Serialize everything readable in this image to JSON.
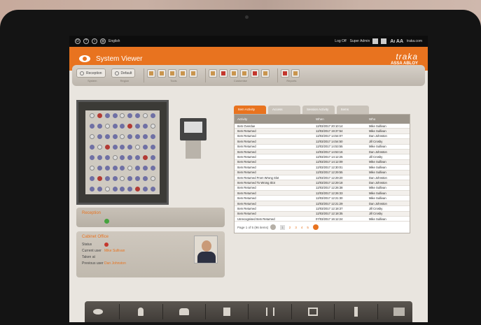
{
  "topbar": {
    "language": "English",
    "log_off": "Log Off",
    "user": "Super Admin",
    "text_size": "Aı AA",
    "site": "traka.com"
  },
  "header": {
    "title": "System Viewer",
    "brand": "traka",
    "brand_sub": "ASSA ABLOY"
  },
  "toolbar": {
    "system_value": "Reception",
    "system_caption": "System",
    "region_value": "Default",
    "region_caption": "Region",
    "tools_caption": "Tools",
    "customise_caption": "Customise",
    "reports_caption": "Reports"
  },
  "reception": {
    "title": "Reception"
  },
  "cabinet_panel": {
    "title": "Cabinet Office",
    "status_label": "Status",
    "current_user_label": "Current user",
    "current_user": "Mike Sullivan",
    "taken_at_label": "Taken at",
    "previous_user_label": "Previous user",
    "previous_user": "Dan Johnston"
  },
  "activity": {
    "tabs": [
      "Item Activity",
      "Access",
      "Session Activity",
      "Items"
    ],
    "columns": [
      "Activity",
      "When",
      "Who"
    ],
    "rows": [
      [
        "Item Overdue",
        "12/03/2017 20:10:14",
        "Mike Sullivan"
      ],
      [
        "Item Returned",
        "12/03/2017 19:37:54",
        "Mike Sullivan"
      ],
      [
        "Item Returned",
        "12/03/2017 14:54:07",
        "Dan Johnston"
      ],
      [
        "Item Returned",
        "12/03/2017 14:54:50",
        "Jill Crosby"
      ],
      [
        "Item Returned",
        "12/03/2017 14:53:55",
        "Mike Sullivan"
      ],
      [
        "Item Returned",
        "12/03/2017 14:53:16",
        "Dan Johnston"
      ],
      [
        "Item Returned",
        "12/03/2017 14:12:25",
        "Jill Crosby"
      ],
      [
        "Item Returned",
        "12/03/2017 14:12:09",
        "Mike Sullivan"
      ],
      [
        "Item Returned",
        "12/03/2017 12:30:01",
        "Mike Sullivan"
      ],
      [
        "Item Returned",
        "12/03/2017 12:29:55",
        "Mike Sullivan"
      ],
      [
        "Item Returned From Wrong Slot",
        "12/03/2017 12:29:20",
        "Dan Johnston"
      ],
      [
        "Item Returned To Wrong Slot",
        "12/03/2017 12:29:18",
        "Dan Johnston"
      ],
      [
        "Item Returned",
        "12/03/2017 12:26:38",
        "Mike Sullivan"
      ],
      [
        "Item Returned",
        "12/03/2017 12:26:33",
        "Mike Sullivan"
      ],
      [
        "Item Returned",
        "12/03/2017 12:21:30",
        "Mike Sullivan"
      ],
      [
        "Item Returned",
        "12/03/2017 12:21:29",
        "Dan Johnston"
      ],
      [
        "Item Returned",
        "12/03/2017 12:18:37",
        "Jill Crosby"
      ],
      [
        "Item Returned",
        "12/03/2017 12:18:35",
        "Jill Crosby"
      ],
      [
        "Unrecognised Item Returned",
        "07/03/2017 16:12:24",
        "Mike Sullivan"
      ]
    ],
    "pager_text": "Page 1 of 5 (96 items)",
    "pages": [
      "1",
      "2",
      "3",
      "4",
      "5"
    ]
  },
  "dock": {
    "icons": [
      "eye-icon",
      "user-icon",
      "users-icon",
      "documents-icon",
      "brackets-icon",
      "screen-icon",
      "key-icon",
      "window-icon"
    ]
  },
  "colors": {
    "accent": "#e8731f",
    "status_ok": "#45a33e",
    "status_alert": "#c4372d"
  }
}
